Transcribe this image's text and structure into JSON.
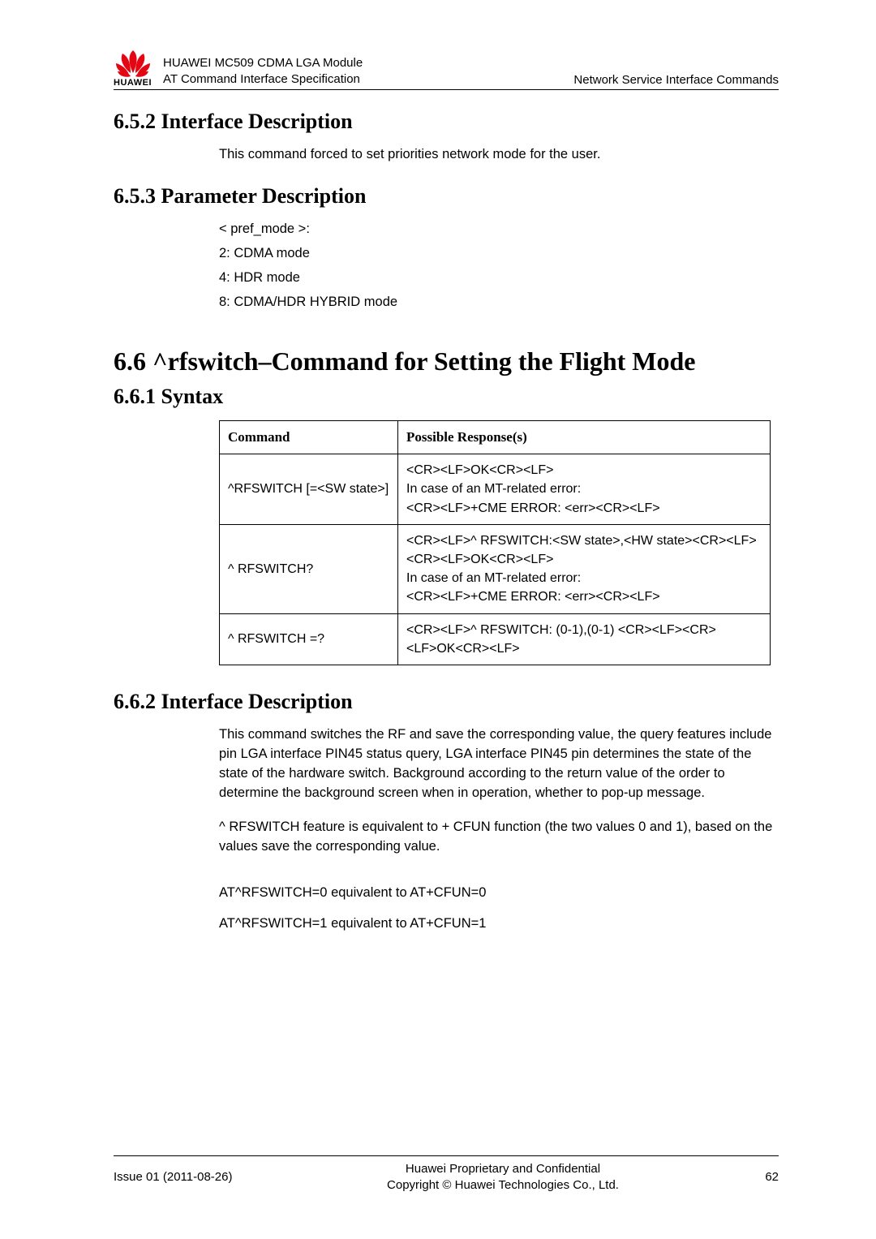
{
  "header": {
    "logo_text": "HUAWEI",
    "title_line1": "HUAWEI MC509 CDMA LGA Module",
    "title_line2": "AT Command Interface Specification",
    "right": "Network Service Interface Commands"
  },
  "sec652": {
    "heading": "6.5.2 Interface Description",
    "body": "This command forced to set priorities network mode for the user."
  },
  "sec653": {
    "heading": "6.5.3 Parameter Description",
    "lines": [
      "< pref_mode >:",
      "2: CDMA mode",
      "4: HDR mode",
      "8: CDMA/HDR HYBRID mode"
    ]
  },
  "sec66": {
    "heading": "6.6 ^rfswitch–Command for Setting the Flight Mode"
  },
  "sec661": {
    "heading": "6.6.1 Syntax",
    "table": {
      "head": [
        "Command",
        "Possible Response(s)"
      ],
      "rows": [
        {
          "cmd": "^RFSWITCH [=<SW state>]",
          "resp": "<CR><LF>OK<CR><LF>\nIn case of an MT-related error:\n<CR><LF>+CME ERROR: <err><CR><LF>"
        },
        {
          "cmd": "^ RFSWITCH?",
          "resp": "<CR><LF>^ RFSWITCH:<SW state>,<HW state><CR><LF><CR><LF>OK<CR><LF>\nIn case of an MT-related error:\n<CR><LF>+CME ERROR: <err><CR><LF>"
        },
        {
          "cmd": "^ RFSWITCH =?",
          "resp": "<CR><LF>^ RFSWITCH: (0-1),(0-1) <CR><LF><CR><LF>OK<CR><LF>"
        }
      ]
    }
  },
  "sec662": {
    "heading": "6.6.2 Interface Description",
    "para1": "This command switches the RF and save the corresponding value, the query features include pin LGA interface PIN45 status query, LGA interface PIN45 pin determines the state of the state of the hardware switch. Background according to the return value of the order to determine the background screen when in operation, whether to pop-up message.",
    "para2": "^ RFSWITCH feature is equivalent to + CFUN function (the two values 0 and 1), based on the values save the corresponding value.",
    "para3": "AT^RFSWITCH=0 equivalent to AT+CFUN=0",
    "para4": "AT^RFSWITCH=1 equivalent to AT+CFUN=1"
  },
  "footer": {
    "left": "Issue 01 (2011-08-26)",
    "center_line1": "Huawei Proprietary and Confidential",
    "center_line2": "Copyright © Huawei Technologies Co., Ltd.",
    "right": "62"
  }
}
